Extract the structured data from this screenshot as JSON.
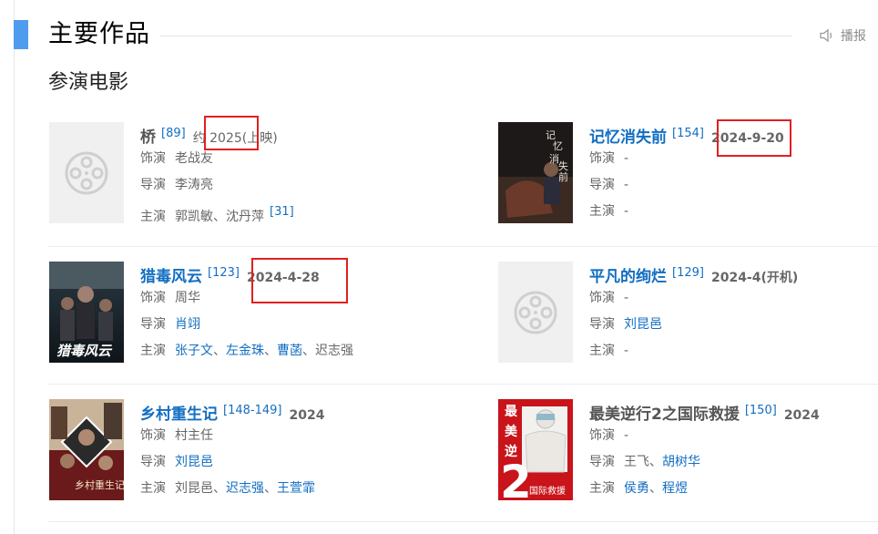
{
  "section_title": "主要作品",
  "play_label": "播报",
  "subsection_title": "参演电影",
  "labels": {
    "role": "饰演",
    "director": "导演",
    "cast": "主演"
  },
  "movies": [
    {
      "title": "桥",
      "cite": "[89]",
      "date": "约 2025(上映)",
      "role": "老战友",
      "director": "李涛亮",
      "cast": "郭凯敏、沈丹萍",
      "cast_cite": "[31]"
    },
    {
      "title": "记忆消失前",
      "cite": "[154]",
      "date": "2024-9-20",
      "role": "-",
      "director": "-",
      "cast": "-"
    },
    {
      "title": "猎毒风云",
      "cite": "[123]",
      "date": "2024-4-28",
      "role": "周华",
      "director": "肖翊",
      "cast_links": [
        "张子文",
        "左金珠",
        "曹菡"
      ],
      "cast_tail": "迟志强"
    },
    {
      "title": "平凡的绚烂",
      "cite": "[129]",
      "date": "2024-4(开机)",
      "role": "-",
      "director": "刘昆邑",
      "cast": "-"
    },
    {
      "title": "乡村重生记",
      "cite": "[148-149]",
      "date": "2024",
      "role": "村主任",
      "director": "刘昆邑",
      "cast_head": "刘昆邑",
      "cast_links": [
        "迟志强",
        "王萱霏"
      ]
    },
    {
      "title": "最美逆行2之国际救援",
      "cite": "[150]",
      "date": "2024",
      "role": "-",
      "director_plain": "王飞",
      "director_link": "胡树华",
      "cast_links": [
        "侯勇",
        "程煜"
      ]
    }
  ],
  "posters": {
    "m2": {
      "title_chars": "记忆消失前"
    },
    "m3": {
      "title_chars": "猎毒风云"
    },
    "m5": {
      "title_chars": "乡村重生记"
    },
    "m6": {
      "side_chars": "最美逆",
      "number": "2",
      "bottom": "国际救援"
    }
  }
}
